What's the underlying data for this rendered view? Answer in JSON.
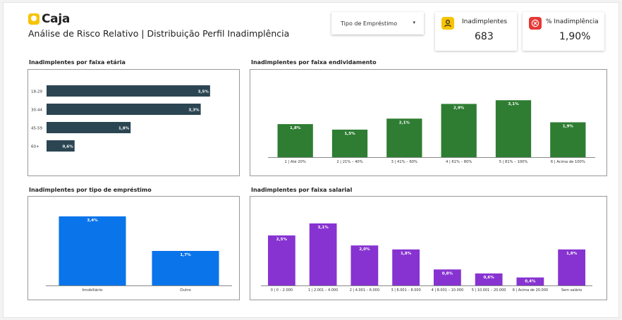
{
  "header": {
    "brand": "Caja",
    "subtitle": "Análise de Risco Relativo | Distribuição Perfil Inadimplência"
  },
  "filter": {
    "label": "Tipo de Empréstimo",
    "arrow": "▾"
  },
  "kpis": [
    {
      "title": "Inadimplentes",
      "value": "683",
      "icon": "user-icon",
      "color": "#f6c400"
    },
    {
      "title": "% Inadimplência",
      "value": "1,90%",
      "icon": "close-circle-icon",
      "color": "#e53935"
    }
  ],
  "sections": {
    "age": "Inadimplentes por faixa etária",
    "debt": "Inadimplentes por faixa endividamento",
    "loan": "Inadimplentes por tipo de empréstimo",
    "salary": "Inadimplentes por faixa salarial"
  },
  "chart_data": [
    {
      "id": "age",
      "type": "bar",
      "orientation": "horizontal",
      "color": "#2b4552",
      "categories": [
        "18-29",
        "30-44",
        "45-59",
        "60+"
      ],
      "values": [
        3.5,
        3.3,
        1.8,
        0.6
      ],
      "labels": [
        "3,5%",
        "3,3%",
        "1,8%",
        "0,6%"
      ],
      "xlim": [
        0,
        4.0
      ]
    },
    {
      "id": "debt",
      "type": "bar",
      "color": "#2e7d32",
      "categories": [
        "1 | Até 20%",
        "2 | 21% – 40%",
        "3 | 41% – 60%",
        "4 | 61% – 80%",
        "5 | 81% – 100%",
        "6 | Acima de 100%"
      ],
      "values": [
        1.8,
        1.5,
        2.1,
        2.9,
        3.1,
        1.9
      ],
      "labels": [
        "1,8%",
        "1,5%",
        "2,1%",
        "2,9%",
        "3,1%",
        "1,9%"
      ],
      "ylim": [
        0,
        3.3
      ]
    },
    {
      "id": "loan",
      "type": "bar",
      "color": "#0a74ea",
      "categories": [
        "Imobiliário",
        "Outro"
      ],
      "values": [
        3.4,
        1.7
      ],
      "labels": [
        "3,4%",
        "1,7%"
      ],
      "ylim": [
        0,
        3.4
      ]
    },
    {
      "id": "salary",
      "type": "bar",
      "color": "#8733d1",
      "categories": [
        "0 | 0 – 2.000",
        "1 | 2.001 – 4.000",
        "2 | 4.001 – 6.000",
        "3 | 6.001 – 8.000",
        "4 | 8.001 – 10.000",
        "5 | 10.001 – 20.000",
        "6 | Acima de 20.000",
        "Sem salário"
      ],
      "values": [
        2.5,
        3.1,
        2.0,
        1.8,
        0.8,
        0.6,
        0.4,
        1.8
      ],
      "labels": [
        "2,5%",
        "3,1%",
        "2,0%",
        "1,8%",
        "0,8%",
        "0,6%",
        "0,4%",
        "1,8%"
      ],
      "ylim": [
        0,
        3.1
      ]
    }
  ]
}
